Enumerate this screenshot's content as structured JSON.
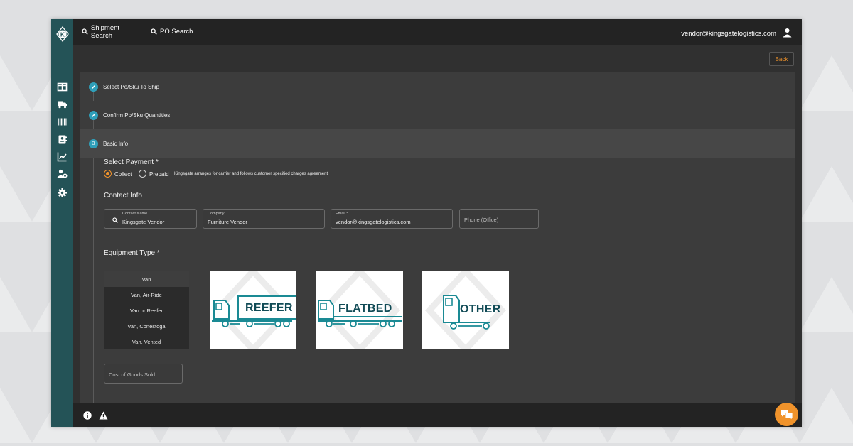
{
  "topbar": {
    "shipment_search_label": "Shipment Search",
    "po_search_label": "PO Search",
    "user_email": "vendor@kingsgatelogistics.com"
  },
  "actions": {
    "back_label": "Back"
  },
  "steps": [
    {
      "label": "Select Po/Sku To Ship",
      "icon": "pencil-icon"
    },
    {
      "label": "Confirm Po/Sku Quantities",
      "icon": "pencil-icon"
    },
    {
      "number": "3",
      "label": "Basic Info"
    }
  ],
  "payment": {
    "title": "Select Payment *",
    "options": [
      "Collect",
      "Prepaid"
    ],
    "selected": "Collect",
    "note": "Kingsgate arranges for carrier and follows customer specified charges agreement"
  },
  "contact": {
    "title": "Contact Info",
    "name_label": "Contact Name",
    "name_value": "Kingsgate Vendor",
    "company_label": "Company",
    "company_value": "Furniture Vendor",
    "email_label": "Email *",
    "email_value": "vendor@kingsgatelogistics.com",
    "phone_placeholder": "Phone (Office)"
  },
  "equipment": {
    "title": "Equipment Type *",
    "list": [
      "Van",
      "Van, Air-Ride",
      "Van or Reefer",
      "Van, Conestoga",
      "Van, Vented"
    ],
    "selected": "Van",
    "cards": [
      "REEFER",
      "FLATBED",
      "OTHER"
    ]
  },
  "cogs_placeholder": "Cost of Goods Sold",
  "colors": {
    "sidebar": "#245357",
    "accent": "#f0932b",
    "step": "#2f9fb9",
    "truck": "#1a8a94",
    "truck_text": "#114b56"
  }
}
